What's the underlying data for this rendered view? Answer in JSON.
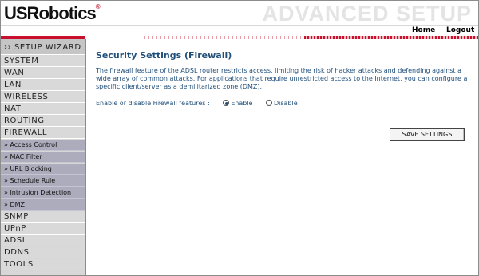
{
  "brand": {
    "logo_text": "USRobotics",
    "section_title": "ADVANCED SETUP"
  },
  "topnav": {
    "home": "Home",
    "logout": "Logout"
  },
  "sidebar": {
    "wizard": "›› SETUP WIZARD",
    "items": [
      "SYSTEM",
      "WAN",
      "LAN",
      "WIRELESS",
      "NAT",
      "ROUTING",
      "FIREWALL"
    ],
    "firewall_sub": [
      "» Access Control",
      "» MAC Filter",
      "» URL Blocking",
      "» Schedule Rule",
      "» Intrusion Detection",
      "» DMZ"
    ],
    "items_after": [
      "SNMP",
      "UPnP",
      "ADSL",
      "DDNS",
      "TOOLS"
    ]
  },
  "main": {
    "title": "Security Settings (Firewall)",
    "description": "The firewall feature of the ADSL router restricts access, limiting the risk of hacker attacks and defending against a wide array of common attacks. For applications that require unrestricted access to the Internet, you can configure a specific client/server as a demilitarized zone (DMZ).",
    "option_label": "Enable or disable Firewall features :",
    "enable_label": "Enable",
    "disable_label": "Disable",
    "selected": "Enable",
    "save_button": "SAVE SETTINGS"
  },
  "colors": {
    "accent": "#c8102e",
    "text": "#1f4e79",
    "sidebar_main": "#d9d9d9",
    "sidebar_sub": "#acacbd"
  }
}
